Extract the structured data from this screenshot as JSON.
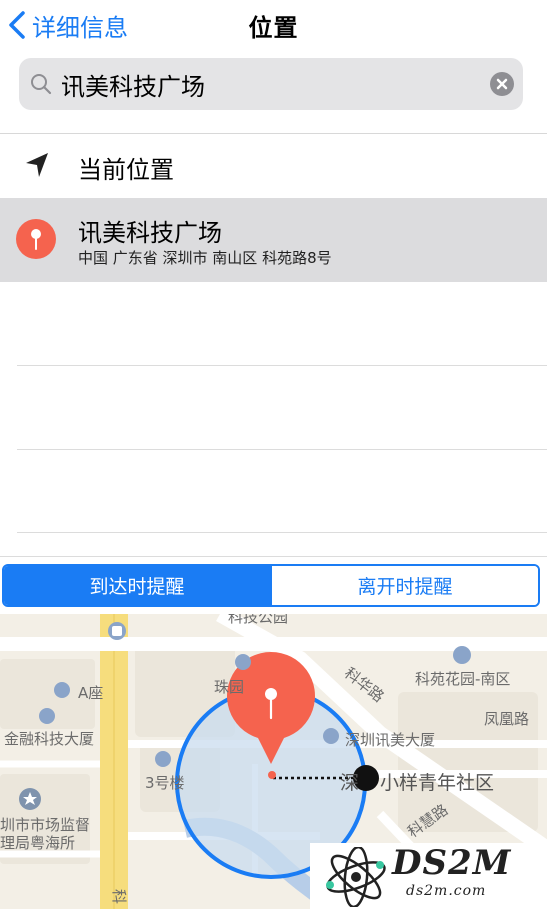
{
  "nav": {
    "back_label": "详细信息",
    "title": "位置"
  },
  "search": {
    "value": "讯美科技广场",
    "search_icon": "search-icon",
    "clear_icon": "clear-icon"
  },
  "list": {
    "current_location": "当前位置",
    "selected_title": "讯美科技广场",
    "selected_subtitle": "中国 广东省 深圳市 南山区 科苑路8号"
  },
  "segmented": {
    "arrive": "到达时提醒",
    "leave": "离开时提醒",
    "selected": "arrive"
  },
  "map": {
    "labels": {
      "a_block": "A座",
      "finance_tower": "金融科技大厦",
      "building3": "3号楼",
      "market_bureau_1": "圳市市场监督",
      "market_bureau_2": "理局粤海所",
      "zhuyuan": "珠园",
      "kehua_road": "科华路",
      "keyuan_garden": "科苑花园-南区",
      "fengxie_road": "凤凰路",
      "xunmei_building": "深圳讯美大厦",
      "shenzhen_part": "深",
      "xiaoyang": "小样青年社区",
      "kehui_road": "科慧路",
      "top_partial": "科技公园",
      "ke_left": "科"
    }
  },
  "colors": {
    "ios_blue": "#1a7cf4",
    "pin_red": "#f5634e",
    "geofence_fill": "#c9dcef",
    "geofence_stroke": "#1a7cf4",
    "selected_row_bg": "#dcdcde"
  },
  "watermark": {
    "brand": "DS2M",
    "url": "ds2m.com"
  }
}
